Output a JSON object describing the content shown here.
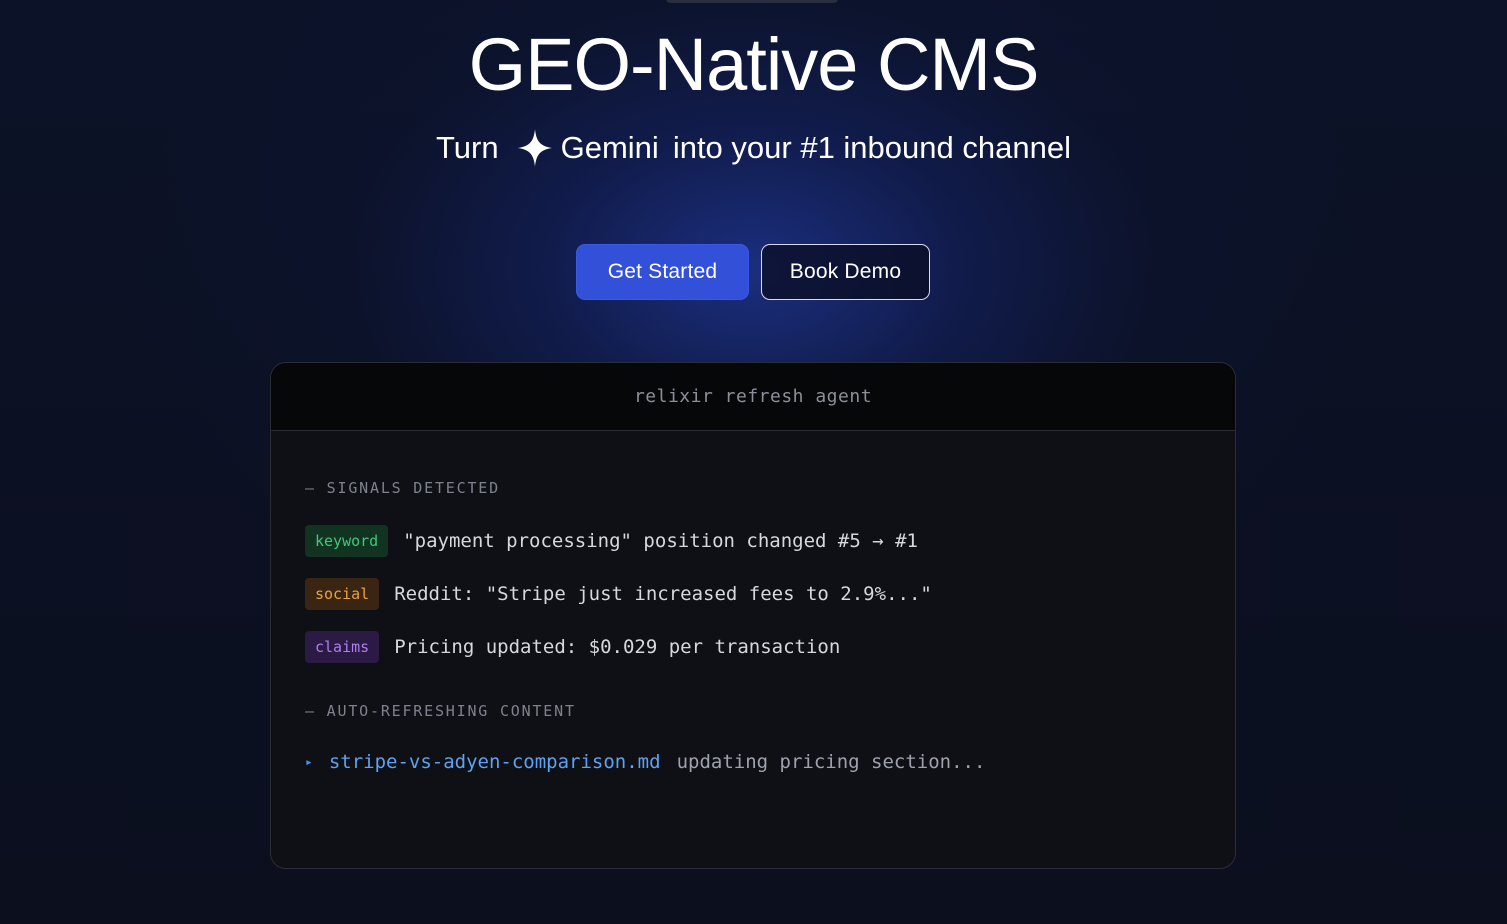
{
  "hero": {
    "title": "GEO-Native CMS",
    "subtitle_prefix": "Turn",
    "subtitle_brand": "Gemini",
    "subtitle_suffix": "into your #1 inbound channel",
    "brand_icon": "gemini-sparkle-icon"
  },
  "buttons": {
    "primary_label": "Get Started",
    "secondary_label": "Book Demo"
  },
  "terminal": {
    "title": "relixir refresh agent",
    "signals_heading": "— SIGNALS DETECTED",
    "signals": [
      {
        "tag": "keyword",
        "text": "\"payment processing\" position changed #5 → #1",
        "color": "#3ec97a"
      },
      {
        "tag": "social",
        "text": "Reddit: \"Stripe just increased fees to 2.9%...\"",
        "color": "#f0a03a"
      },
      {
        "tag": "claims",
        "text": "Pricing updated: $0.029 per transaction",
        "color": "#b07ef0"
      }
    ],
    "refresh_heading": "— AUTO-REFRESHING CONTENT",
    "refresh_item": {
      "marker": "▸",
      "file": "stripe-vs-adyen-comparison.md",
      "status": "updating pricing section..."
    }
  },
  "colors": {
    "background": "#0b0f1e",
    "primary_button": "#3350d8",
    "glow": "#2846c8",
    "terminal_bg": "#0e1016"
  }
}
